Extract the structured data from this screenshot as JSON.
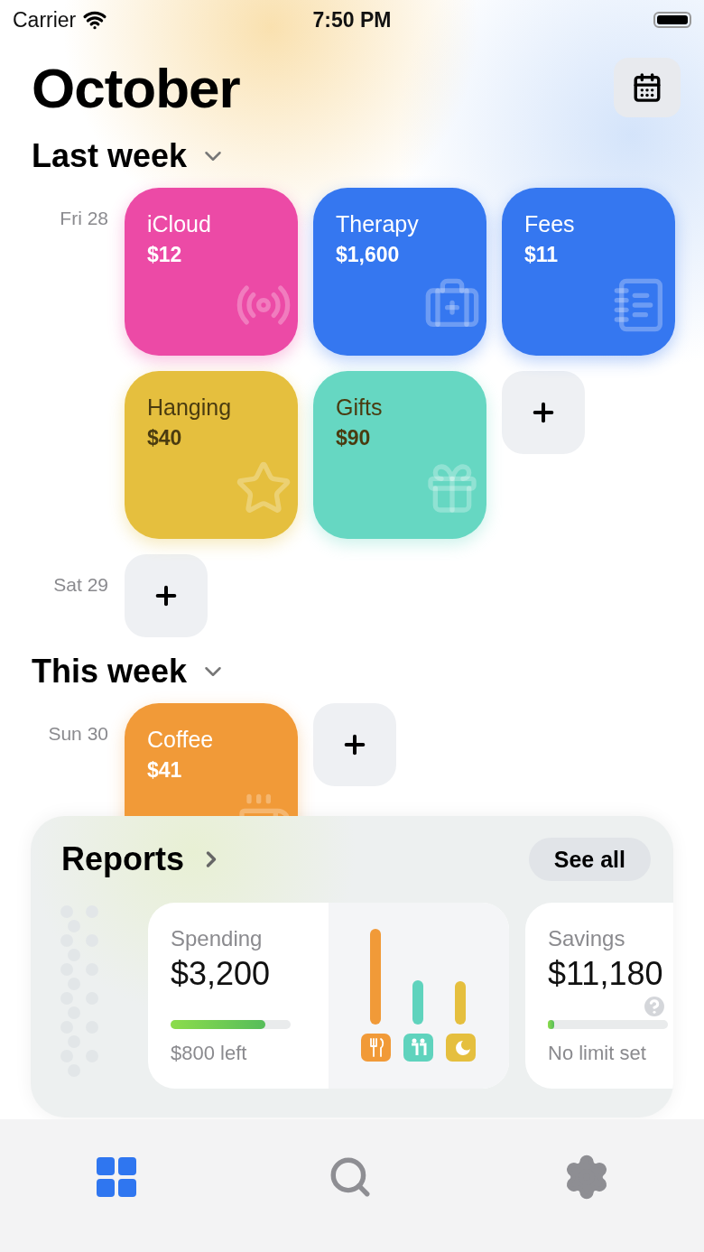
{
  "status_bar": {
    "carrier": "Carrier",
    "time": "7:50 PM"
  },
  "header": {
    "title": "October"
  },
  "sections": [
    {
      "title": "Last week",
      "expanded": true,
      "days": [
        {
          "label": "Fri 28",
          "expenses": [
            {
              "name": "iCloud",
              "amount": "$12",
              "color": "#ec4aa6",
              "kind": "radio"
            },
            {
              "name": "Therapy",
              "amount": "$1,600",
              "color": "#3577f0",
              "kind": "medkit"
            },
            {
              "name": "Fees",
              "amount": "$11",
              "color": "#3577f0",
              "kind": "notes"
            },
            {
              "name": "Hanging",
              "amount": "$40",
              "color": "#e5bf3e",
              "kind": "star"
            },
            {
              "name": "Gifts",
              "amount": "$90",
              "color": "#66d7c2",
              "kind": "gift"
            }
          ]
        },
        {
          "label": "Sat 29"
        }
      ]
    },
    {
      "title": "This week",
      "expanded": true,
      "days": [
        {
          "label": "Sun 30",
          "expenses": [
            {
              "name": "Coffee",
              "amount": "$41",
              "color": "#f19a38",
              "kind": "cup"
            }
          ]
        }
      ]
    }
  ],
  "reports": {
    "title": "Reports",
    "see_all": "See all",
    "cards": [
      {
        "kind": "spending",
        "label": "Spending",
        "amount": "$3,200",
        "level": 0.79,
        "caption": "$800 left"
      },
      {
        "kind": "savings",
        "label": "Savings",
        "amount": "$11,180",
        "level": 0.03,
        "caption": "No limit set"
      }
    ]
  },
  "tabs": [
    {
      "kind": "home",
      "selected": true
    },
    {
      "kind": "search",
      "selected": false
    },
    {
      "kind": "settings",
      "selected": false
    }
  ]
}
